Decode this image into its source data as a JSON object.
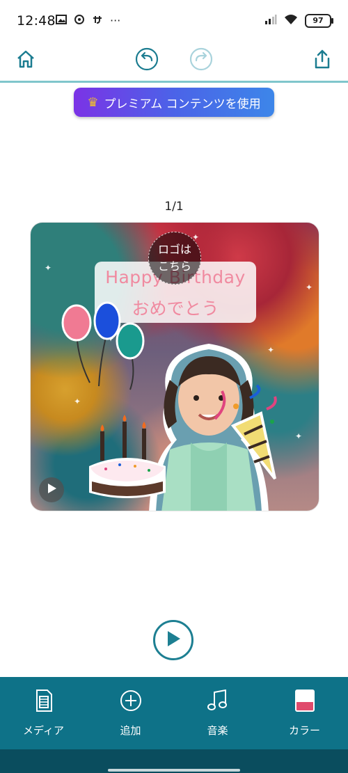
{
  "status_bar": {
    "time": "12:48",
    "icons": [
      "gallery-icon",
      "target-icon",
      "custom-app-icon",
      "more-icon"
    ],
    "more": "···",
    "battery": "97"
  },
  "toolbar": {
    "home": "home-icon",
    "undo": "undo-icon",
    "redo": "redo-icon",
    "share": "share-icon"
  },
  "premium": {
    "label": "プレミアム コンテンツを使用"
  },
  "page_indicator": "1/1",
  "preview": {
    "title_line1": "Happy Birthday",
    "title_line2": "おめでとう",
    "logo_spot": "ロゴは\nこちら"
  },
  "bottom_nav": {
    "items": [
      {
        "label": "メディア",
        "icon": "film-icon"
      },
      {
        "label": "追加",
        "icon": "add-circle-icon"
      },
      {
        "label": "音楽",
        "icon": "music-note-icon"
      },
      {
        "label": "カラー",
        "icon": "color-swatch-icon"
      }
    ]
  },
  "colors": {
    "teal": "#0e7288",
    "accent_line": "#7fc6cc",
    "premium_from": "#7b33e6",
    "premium_to": "#3d86e9"
  }
}
